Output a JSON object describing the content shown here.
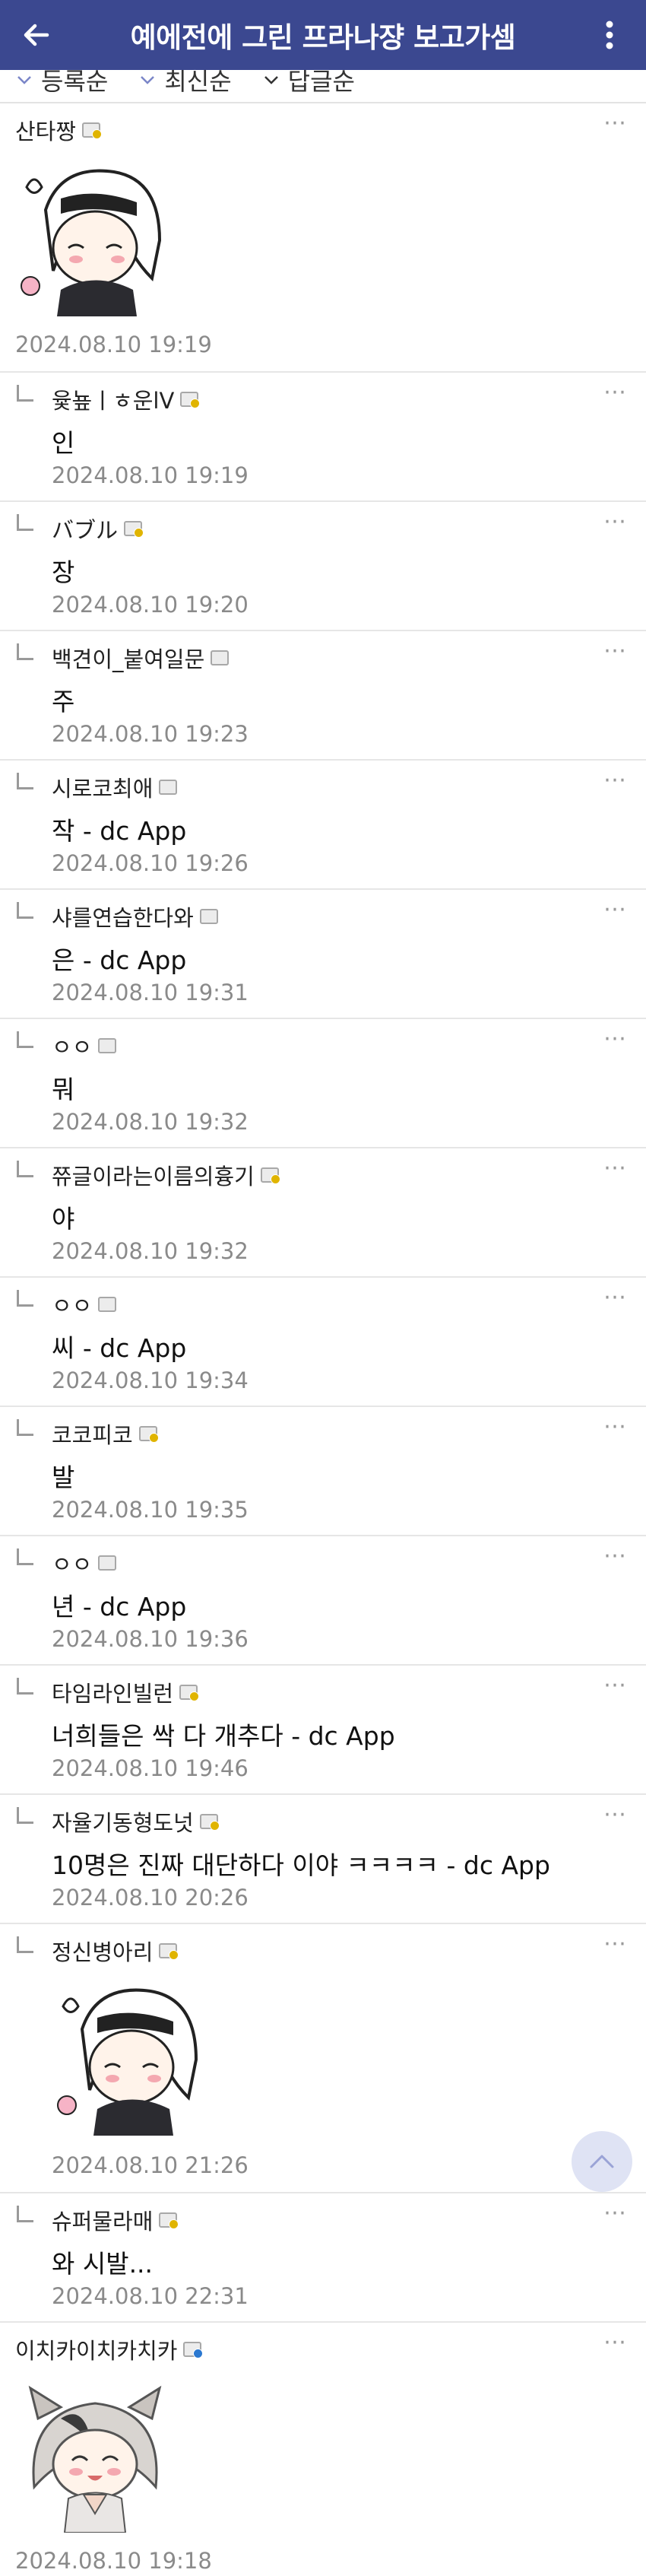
{
  "appbar": {
    "title": "예에전에 그린 프라나쟝 보고가셈"
  },
  "sort": {
    "options": [
      "등록순",
      "최신순",
      "답글순"
    ]
  },
  "comments": [
    {
      "user": "산타짱",
      "badge": "gold",
      "text": "",
      "date": "2024.08.10 19:19",
      "reply": false,
      "sticker": "sticker-image"
    },
    {
      "user": "윷눂ㅣㅎ운lV",
      "badge": "gold",
      "text": "인",
      "date": "2024.08.10 19:19",
      "reply": true
    },
    {
      "user": "バブル",
      "badge": "gold",
      "text": "장",
      "date": "2024.08.10 19:20",
      "reply": true
    },
    {
      "user": "백견이_붙여일문",
      "badge": "gray",
      "text": "주",
      "date": "2024.08.10 19:23",
      "reply": true
    },
    {
      "user": "시로코최애",
      "badge": "gray",
      "text": "작 - dc App",
      "date": "2024.08.10 19:26",
      "reply": true
    },
    {
      "user": "샤를연습한다와",
      "badge": "gray",
      "text": "은 - dc App",
      "date": "2024.08.10 19:31",
      "reply": true
    },
    {
      "user": "ㅇㅇ",
      "badge": "gray",
      "text": "뭐",
      "date": "2024.08.10 19:32",
      "reply": true
    },
    {
      "user": "쮸글이라는이름의흉기",
      "badge": "gold",
      "text": "야",
      "date": "2024.08.10 19:32",
      "reply": true
    },
    {
      "user": "ㅇㅇ",
      "badge": "gray",
      "text": "씨 - dc App",
      "date": "2024.08.10 19:34",
      "reply": true
    },
    {
      "user": "코코피코",
      "badge": "gold",
      "text": "발",
      "date": "2024.08.10 19:35",
      "reply": true
    },
    {
      "user": "ㅇㅇ",
      "badge": "gray",
      "text": "년 - dc App",
      "date": "2024.08.10 19:36",
      "reply": true
    },
    {
      "user": "타임라인빌런",
      "badge": "gold",
      "text": "너희들은 싹 다 개추다 - dc App",
      "date": "2024.08.10 19:46",
      "reply": true
    },
    {
      "user": "자율기동형도넛",
      "badge": "gold",
      "text": "10명은 진짜 대단하다 이야 ㅋㅋㅋㅋ - dc App",
      "date": "2024.08.10 20:26",
      "reply": true
    },
    {
      "user": "정신병아리",
      "badge": "gold",
      "text": "",
      "date": "2024.08.10 21:26",
      "reply": true,
      "sticker": "sticker-image"
    },
    {
      "user": "슈퍼물라매",
      "badge": "gold",
      "text": "와 시발...",
      "date": "2024.08.10 22:31",
      "reply": true
    },
    {
      "user": "이치카이치카치카",
      "badge": "blue",
      "text": "",
      "date": "2024.08.10 19:18",
      "reply": false,
      "sticker": "sticker-image-2"
    }
  ],
  "icons": {
    "back": "back-arrow-icon",
    "menu": "more-vert-icon",
    "fab": "scroll-top-icon"
  },
  "colors": {
    "appbar": "#3b4890",
    "fab": "#dfe3f4"
  }
}
